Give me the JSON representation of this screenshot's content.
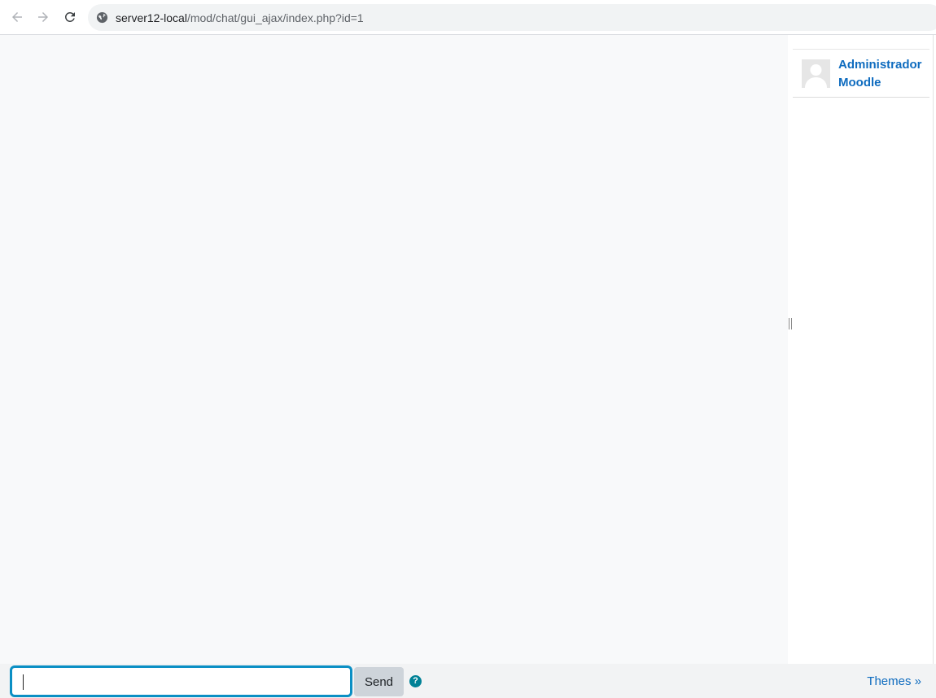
{
  "browser": {
    "url_host": "server12-local",
    "url_path": "/mod/chat/gui_ajax/index.php?id=1"
  },
  "users": [
    {
      "name": "Administrador Moodle"
    }
  ],
  "composer": {
    "input_value": "",
    "send_label": "Send",
    "help_label": "?",
    "themes_label": "Themes »"
  },
  "colors": {
    "accent": "#0f6cbf",
    "focus": "#0b8fc4",
    "help": "#008196"
  }
}
